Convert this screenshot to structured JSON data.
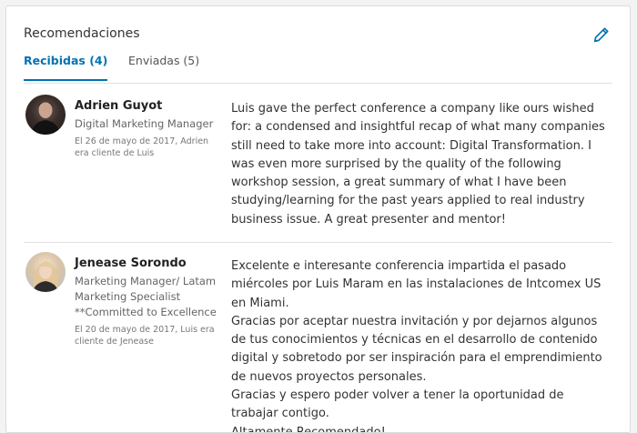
{
  "section": {
    "title": "Recomendaciones"
  },
  "tabs": [
    {
      "label": "Recibidas (4)",
      "active": true
    },
    {
      "label": "Enviadas (5)",
      "active": false
    }
  ],
  "colors": {
    "accent": "#0073b1",
    "text": "#333333",
    "muted": "#666666"
  },
  "icons": {
    "edit": "pencil-icon"
  },
  "recommendations": [
    {
      "name": "Adrien Guyot",
      "headline": "Digital Marketing Manager",
      "meta": "El 26 de mayo de 2017, Adrien era cliente de Luis",
      "text": "Luis gave the perfect conference a company like ours wished for: a condensed and insightful recap of what many companies still need to take more into account: Digital Transformation. I was even more surprised by the quality of the following workshop session, a great summary of what I have been studying/learning for the past years applied to real industry business issue. A great presenter and mentor!"
    },
    {
      "name": "Jenease Sorondo",
      "headline": "Marketing Manager/ Latam Marketing Specialist **Committed to Excellence",
      "meta": "El 20 de mayo de 2017, Luis era cliente de Jenease",
      "text": "Excelente e interesante conferencia impartida el pasado miércoles por Luis Maram en las instalaciones de Intcomex US en Miami.\nGracias por aceptar nuestra invitación y por dejarnos algunos de tus conocimientos y técnicas en el desarrollo de contenido digital y sobretodo por ser inspiración para el emprendimiento de nuevos proyectos personales.\nGracias y espero poder volver a tener la oportunidad de trabajar contigo.\nAltamente Recomendado!"
    }
  ]
}
